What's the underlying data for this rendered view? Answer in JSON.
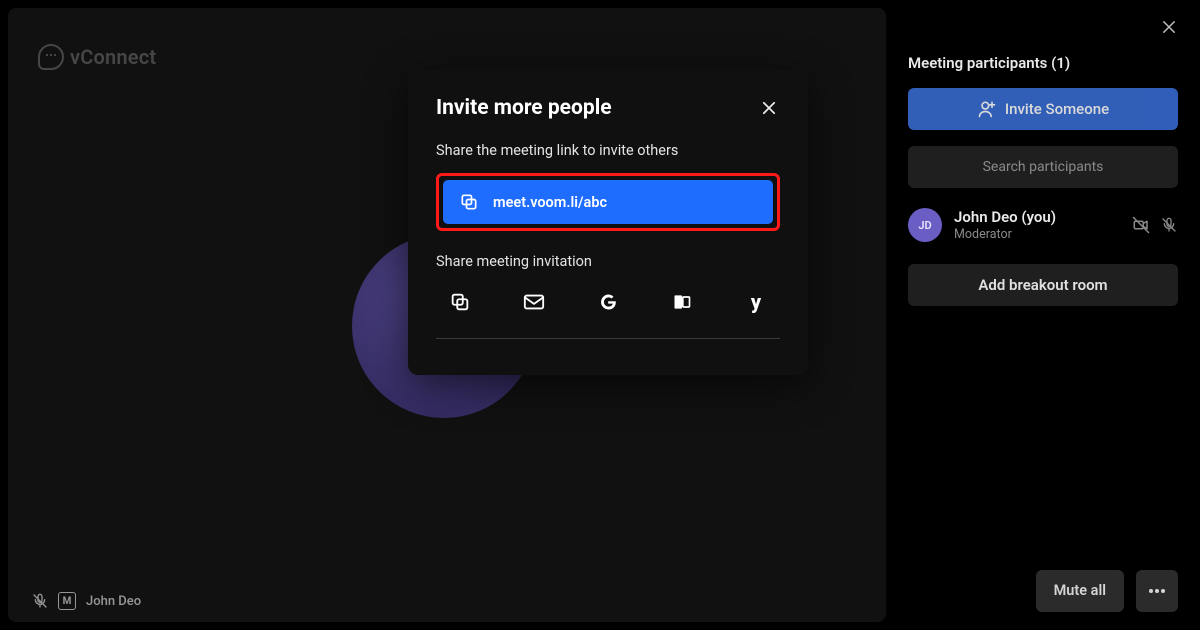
{
  "brand": {
    "name": "vConnect"
  },
  "footer": {
    "speaker_name": "John Deo",
    "badge_letter": "M"
  },
  "modal": {
    "title": "Invite more people",
    "share_link_label": "Share the meeting link to invite others",
    "meeting_link": "meet.voom.li/abc",
    "share_invitation_label": "Share meeting invitation",
    "share_targets": {
      "copy": "copy",
      "email": "email",
      "google": "google",
      "outlook": "outlook",
      "yahoo": "yahoo"
    }
  },
  "side": {
    "title": "Meeting participants (1)",
    "invite_label": "Invite Someone",
    "search_placeholder": "Search participants",
    "breakout_label": "Add breakout room",
    "mute_all_label": "Mute all"
  },
  "participant": {
    "initials": "JD",
    "name": "John Deo (you)",
    "role": "Moderator"
  }
}
